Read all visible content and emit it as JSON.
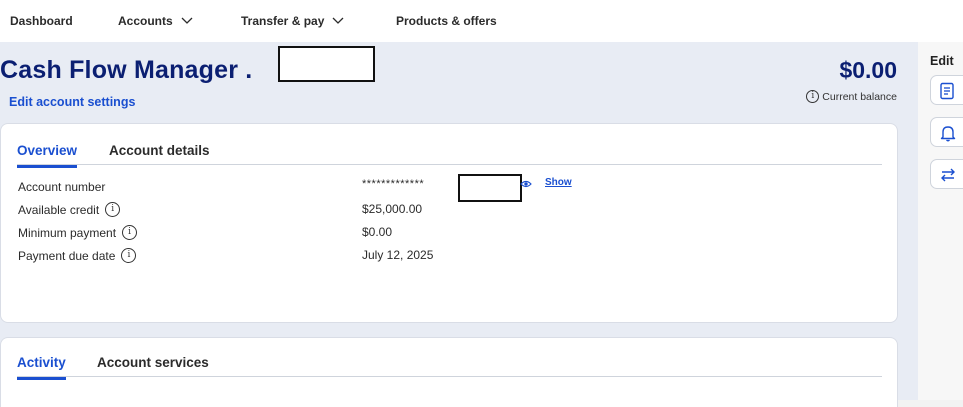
{
  "nav": {
    "items": [
      {
        "label": "Dashboard",
        "has_chevron": false
      },
      {
        "label": "Accounts",
        "has_chevron": true
      },
      {
        "label": "Transfer & pay",
        "has_chevron": true
      },
      {
        "label": "Products & offers",
        "has_chevron": false
      }
    ]
  },
  "header": {
    "title": "Cash Flow Manager .",
    "edit_settings": "Edit account settings",
    "balance": "$0.00",
    "balance_label": "Current balance"
  },
  "overview": {
    "tabs": [
      "Overview",
      "Account details"
    ],
    "active_tab": "Overview",
    "rows": [
      {
        "label": "Account number",
        "value": "*************",
        "has_info": false
      },
      {
        "label": "Available credit",
        "value": "$25,000.00",
        "has_info": true
      },
      {
        "label": "Minimum payment",
        "value": "$0.00",
        "has_info": true
      },
      {
        "label": "Payment due date",
        "value": "July 12, 2025",
        "has_info": true
      }
    ],
    "show_link": "Show"
  },
  "activity": {
    "tabs": [
      "Activity",
      "Account services"
    ],
    "active_tab": "Activity"
  },
  "rightbar": {
    "label": "Edit",
    "buttons": [
      "document-icon",
      "bell-icon",
      "transfer-arrows-icon"
    ]
  },
  "colors": {
    "accent": "#1a4fd0",
    "title": "#0b1f72",
    "page_bg": "#e8ecf4"
  }
}
